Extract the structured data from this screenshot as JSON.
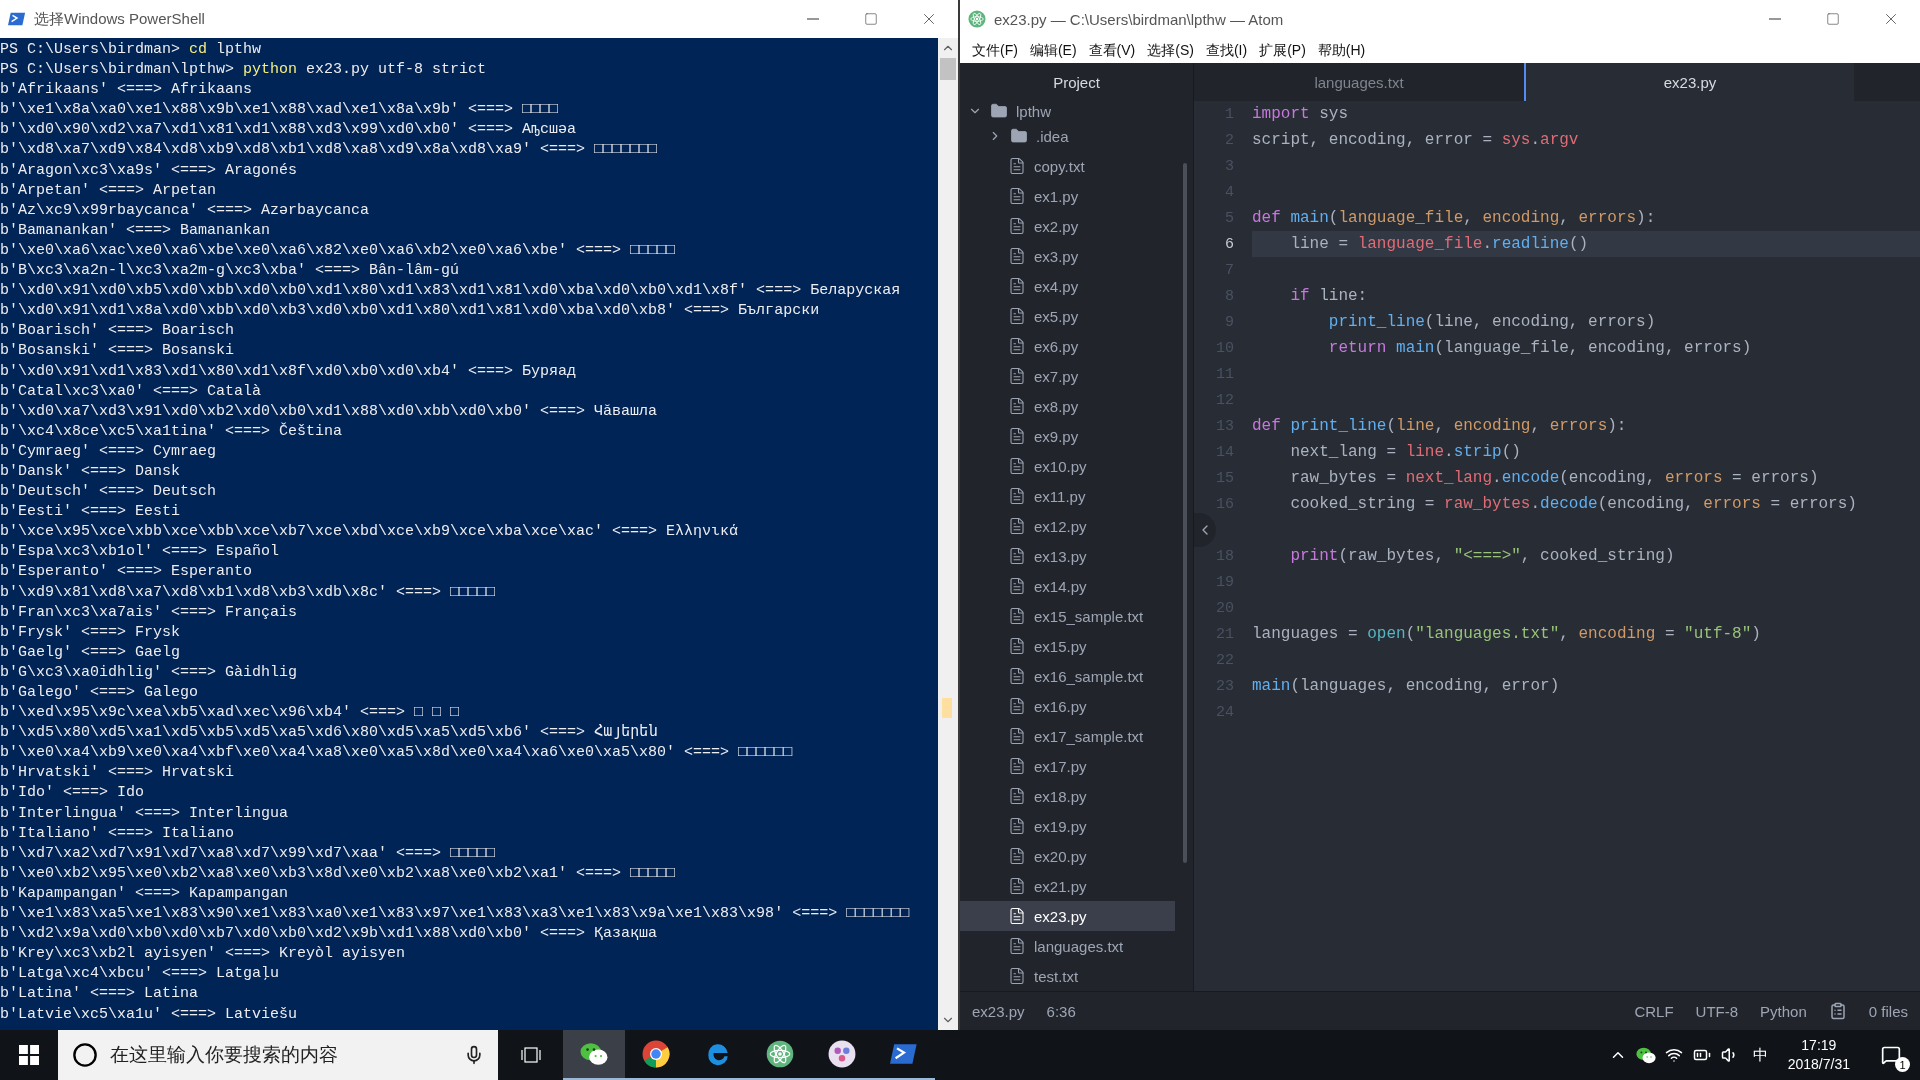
{
  "powershell": {
    "title": "选择Windows PowerShell",
    "lines": [
      {
        "kind": "prompt",
        "prompt": "PS C:\\Users\\birdman> ",
        "command": "cd",
        "args": " lpthw"
      },
      {
        "kind": "prompt",
        "prompt": "PS C:\\Users\\birdman\\lpthw> ",
        "command": "python",
        "args": " ex23.py utf-8 strict"
      },
      {
        "kind": "output",
        "text": "b'Afrikaans' <===> Afrikaans"
      },
      {
        "kind": "output",
        "text": "b'\\xe1\\x8a\\xa0\\xe1\\x88\\x9b\\xe1\\x88\\xad\\xe1\\x8a\\x9b' <===> □□□□"
      },
      {
        "kind": "output",
        "text": "b'\\xd0\\x90\\xd2\\xa7\\xd1\\x81\\xd1\\x88\\xd3\\x99\\xd0\\xb0' <===> Аҧсшәа"
      },
      {
        "kind": "output",
        "text": "b'\\xd8\\xa7\\xd9\\x84\\xd8\\xb9\\xd8\\xb1\\xd8\\xa8\\xd9\\x8a\\xd8\\xa9' <===> □□□□□□□"
      },
      {
        "kind": "output",
        "text": "b'Aragon\\xc3\\xa9s' <===> Aragonés"
      },
      {
        "kind": "output",
        "text": "b'Arpetan' <===> Arpetan"
      },
      {
        "kind": "output",
        "text": "b'Az\\xc9\\x99rbaycanca' <===> Azərbaycanca"
      },
      {
        "kind": "output",
        "text": "b'Bamanankan' <===> Bamanankan"
      },
      {
        "kind": "output",
        "text": "b'\\xe0\\xa6\\xac\\xe0\\xa6\\xbe\\xe0\\xa6\\x82\\xe0\\xa6\\xb2\\xe0\\xa6\\xbe' <===> □□□□□"
      },
      {
        "kind": "output",
        "text": "b'B\\xc3\\xa2n-l\\xc3\\xa2m-g\\xc3\\xba' <===> Bân-lâm-gú"
      },
      {
        "kind": "output",
        "text": "b'\\xd0\\x91\\xd0\\xb5\\xd0\\xbb\\xd0\\xb0\\xd1\\x80\\xd1\\x83\\xd1\\x81\\xd0\\xba\\xd0\\xb0\\xd1\\x8f' <===> Беларуская"
      },
      {
        "kind": "output",
        "text": "b'\\xd0\\x91\\xd1\\x8a\\xd0\\xbb\\xd0\\xb3\\xd0\\xb0\\xd1\\x80\\xd1\\x81\\xd0\\xba\\xd0\\xb8' <===> Български"
      },
      {
        "kind": "output",
        "text": "b'Boarisch' <===> Boarisch"
      },
      {
        "kind": "output",
        "text": "b'Bosanski' <===> Bosanski"
      },
      {
        "kind": "output",
        "text": "b'\\xd0\\x91\\xd1\\x83\\xd1\\x80\\xd1\\x8f\\xd0\\xb0\\xd0\\xb4' <===> Буряад"
      },
      {
        "kind": "output",
        "text": "b'Catal\\xc3\\xa0' <===> Català"
      },
      {
        "kind": "output",
        "text": "b'\\xd0\\xa7\\xd3\\x91\\xd0\\xb2\\xd0\\xb0\\xd1\\x88\\xd0\\xbb\\xd0\\xb0' <===> Чӑвашла"
      },
      {
        "kind": "output",
        "text": "b'\\xc4\\x8ce\\xc5\\xa1tina' <===> Čeština"
      },
      {
        "kind": "output",
        "text": "b'Cymraeg' <===> Cymraeg"
      },
      {
        "kind": "output",
        "text": "b'Dansk' <===> Dansk"
      },
      {
        "kind": "output",
        "text": "b'Deutsch' <===> Deutsch"
      },
      {
        "kind": "output",
        "text": "b'Eesti' <===> Eesti"
      },
      {
        "kind": "output",
        "text": "b'\\xce\\x95\\xce\\xbb\\xce\\xbb\\xce\\xb7\\xce\\xbd\\xce\\xb9\\xce\\xba\\xce\\xac' <===> Ελληνικά"
      },
      {
        "kind": "output",
        "text": "b'Espa\\xc3\\xb1ol' <===> Español"
      },
      {
        "kind": "output",
        "text": "b'Esperanto' <===> Esperanto"
      },
      {
        "kind": "output",
        "text": "b'\\xd9\\x81\\xd8\\xa7\\xd8\\xb1\\xd8\\xb3\\xdb\\x8c' <===> □□□□□"
      },
      {
        "kind": "output",
        "text": "b'Fran\\xc3\\xa7ais' <===> Français"
      },
      {
        "kind": "output",
        "text": "b'Frysk' <===> Frysk"
      },
      {
        "kind": "output",
        "text": "b'Gaelg' <===> Gaelg"
      },
      {
        "kind": "output",
        "text": "b'G\\xc3\\xa0idhlig' <===> Gàidhlig"
      },
      {
        "kind": "output",
        "text": "b'Galego' <===> Galego"
      },
      {
        "kind": "output",
        "text": "b'\\xed\\x95\\x9c\\xea\\xb5\\xad\\xec\\x96\\xb4' <===> □ □ □"
      },
      {
        "kind": "output",
        "text": "b'\\xd5\\x80\\xd5\\xa1\\xd5\\xb5\\xd5\\xa5\\xd6\\x80\\xd5\\xa5\\xd5\\xb6' <===> Հայերեն"
      },
      {
        "kind": "output",
        "text": "b'\\xe0\\xa4\\xb9\\xe0\\xa4\\xbf\\xe0\\xa4\\xa8\\xe0\\xa5\\x8d\\xe0\\xa4\\xa6\\xe0\\xa5\\x80' <===> □□□□□□"
      },
      {
        "kind": "output",
        "text": "b'Hrvatski' <===> Hrvatski"
      },
      {
        "kind": "output",
        "text": "b'Ido' <===> Ido"
      },
      {
        "kind": "output",
        "text": "b'Interlingua' <===> Interlingua"
      },
      {
        "kind": "output",
        "text": "b'Italiano' <===> Italiano"
      },
      {
        "kind": "output",
        "text": "b'\\xd7\\xa2\\xd7\\x91\\xd7\\xa8\\xd7\\x99\\xd7\\xaa' <===> □□□□□"
      },
      {
        "kind": "output",
        "text": "b'\\xe0\\xb2\\x95\\xe0\\xb2\\xa8\\xe0\\xb3\\x8d\\xe0\\xb2\\xa8\\xe0\\xb2\\xa1' <===> □□□□□"
      },
      {
        "kind": "output",
        "text": "b'Kapampangan' <===> Kapampangan"
      },
      {
        "kind": "output",
        "text": "b'\\xe1\\x83\\xa5\\xe1\\x83\\x90\\xe1\\x83\\xa0\\xe1\\x83\\x97\\xe1\\x83\\xa3\\xe1\\x83\\x9a\\xe1\\x83\\x98' <===> □□□□□□□"
      },
      {
        "kind": "output",
        "text": "b'\\xd2\\x9a\\xd0\\xb0\\xd0\\xb7\\xd0\\xb0\\xd2\\x9b\\xd1\\x88\\xd0\\xb0' <===> Қазақша"
      },
      {
        "kind": "output",
        "text": "b'Krey\\xc3\\xb2l ayisyen' <===> Kreyòl ayisyen"
      },
      {
        "kind": "output",
        "text": "b'Latga\\xc4\\xbcu' <===> Latgaļu"
      },
      {
        "kind": "output",
        "text": "b'Latina' <===> Latina"
      },
      {
        "kind": "output",
        "text": "b'Latvie\\xc5\\xa1u' <===> Latviešu"
      }
    ]
  },
  "atom": {
    "title": "ex23.py — C:\\Users\\birdman\\lpthw — Atom",
    "menu": [
      "文件(F)",
      "编辑(E)",
      "查看(V)",
      "选择(S)",
      "查找(I)",
      "扩展(P)",
      "帮助(H)"
    ],
    "tree": {
      "header": "Project",
      "root": {
        "name": "lpthw",
        "expanded": true,
        "children": [
          {
            "kind": "folder",
            "name": ".idea",
            "expanded": false,
            "selected": false
          },
          {
            "kind": "file",
            "name": "copy.txt",
            "selected": false
          },
          {
            "kind": "file",
            "name": "ex1.py",
            "selected": false
          },
          {
            "kind": "file",
            "name": "ex2.py",
            "selected": false
          },
          {
            "kind": "file",
            "name": "ex3.py",
            "selected": false
          },
          {
            "kind": "file",
            "name": "ex4.py",
            "selected": false
          },
          {
            "kind": "file",
            "name": "ex5.py",
            "selected": false
          },
          {
            "kind": "file",
            "name": "ex6.py",
            "selected": false
          },
          {
            "kind": "file",
            "name": "ex7.py",
            "selected": false
          },
          {
            "kind": "file",
            "name": "ex8.py",
            "selected": false
          },
          {
            "kind": "file",
            "name": "ex9.py",
            "selected": false
          },
          {
            "kind": "file",
            "name": "ex10.py",
            "selected": false
          },
          {
            "kind": "file",
            "name": "ex11.py",
            "selected": false
          },
          {
            "kind": "file",
            "name": "ex12.py",
            "selected": false
          },
          {
            "kind": "file",
            "name": "ex13.py",
            "selected": false
          },
          {
            "kind": "file",
            "name": "ex14.py",
            "selected": false
          },
          {
            "kind": "file",
            "name": "ex15_sample.txt",
            "selected": false
          },
          {
            "kind": "file",
            "name": "ex15.py",
            "selected": false
          },
          {
            "kind": "file",
            "name": "ex16_sample.txt",
            "selected": false
          },
          {
            "kind": "file",
            "name": "ex16.py",
            "selected": false
          },
          {
            "kind": "file",
            "name": "ex17_sample.txt",
            "selected": false
          },
          {
            "kind": "file",
            "name": "ex17.py",
            "selected": false
          },
          {
            "kind": "file",
            "name": "ex18.py",
            "selected": false
          },
          {
            "kind": "file",
            "name": "ex19.py",
            "selected": false
          },
          {
            "kind": "file",
            "name": "ex20.py",
            "selected": false
          },
          {
            "kind": "file",
            "name": "ex21.py",
            "selected": false
          },
          {
            "kind": "file",
            "name": "ex23.py",
            "selected": true
          },
          {
            "kind": "file",
            "name": "languages.txt",
            "selected": false
          },
          {
            "kind": "file",
            "name": "test.txt",
            "selected": false
          }
        ]
      }
    },
    "tabs": [
      {
        "label": "languages.txt",
        "selected": false
      },
      {
        "label": "ex23.py",
        "selected": true
      }
    ],
    "lines": [
      {
        "number": "1",
        "current": false,
        "tokens": [
          {
            "kind": "keyword",
            "text": "import"
          },
          {
            "kind": "plain",
            "text": " sys"
          }
        ]
      },
      {
        "number": "2",
        "current": false,
        "tokens": [
          {
            "kind": "plain",
            "text": "script, encoding, error = "
          },
          {
            "kind": "variable",
            "text": "sys"
          },
          {
            "kind": "plain",
            "text": "."
          },
          {
            "kind": "variable",
            "text": "argv"
          }
        ]
      },
      {
        "number": "3",
        "current": false
      },
      {
        "number": "4",
        "current": false
      },
      {
        "number": "5",
        "current": false,
        "tokens": [
          {
            "kind": "keyword",
            "text": "def "
          },
          {
            "kind": "function",
            "text": "main"
          },
          {
            "kind": "plain",
            "text": "("
          },
          {
            "kind": "param",
            "text": "language_file"
          },
          {
            "kind": "plain",
            "text": ", "
          },
          {
            "kind": "param",
            "text": "encoding"
          },
          {
            "kind": "plain",
            "text": ", "
          },
          {
            "kind": "param",
            "text": "errors"
          },
          {
            "kind": "plain",
            "text": "):"
          }
        ]
      },
      {
        "number": "6",
        "current": true,
        "tokens": [
          {
            "kind": "plain",
            "text": "    line = "
          },
          {
            "kind": "variable",
            "text": "language_file"
          },
          {
            "kind": "plain",
            "text": "."
          },
          {
            "kind": "function",
            "text": "readline"
          },
          {
            "kind": "plain",
            "text": "()"
          }
        ]
      },
      {
        "number": "7",
        "current": false
      },
      {
        "number": "8",
        "current": false,
        "tokens": [
          {
            "kind": "keyword",
            "text": "    if"
          },
          {
            "kind": "plain",
            "text": " line:"
          }
        ]
      },
      {
        "number": "9",
        "current": false,
        "tokens": [
          {
            "kind": "function",
            "text": "        print_line"
          },
          {
            "kind": "plain",
            "text": "(line, encoding, errors)"
          }
        ]
      },
      {
        "number": "10",
        "current": false,
        "tokens": [
          {
            "kind": "keyword",
            "text": "        return "
          },
          {
            "kind": "function",
            "text": "main"
          },
          {
            "kind": "plain",
            "text": "(language_file, encoding, errors)"
          }
        ]
      },
      {
        "number": "11",
        "current": false
      },
      {
        "number": "12",
        "current": false
      },
      {
        "number": "13",
        "current": false,
        "tokens": [
          {
            "kind": "keyword",
            "text": "def "
          },
          {
            "kind": "function",
            "text": "print_line"
          },
          {
            "kind": "plain",
            "text": "("
          },
          {
            "kind": "param",
            "text": "line"
          },
          {
            "kind": "plain",
            "text": ", "
          },
          {
            "kind": "param",
            "text": "encoding"
          },
          {
            "kind": "plain",
            "text": ", "
          },
          {
            "kind": "param",
            "text": "errors"
          },
          {
            "kind": "plain",
            "text": "):"
          }
        ]
      },
      {
        "number": "14",
        "current": false,
        "tokens": [
          {
            "kind": "plain",
            "text": "    next_lang = "
          },
          {
            "kind": "variable",
            "text": "line"
          },
          {
            "kind": "plain",
            "text": "."
          },
          {
            "kind": "function",
            "text": "strip"
          },
          {
            "kind": "plain",
            "text": "()"
          }
        ]
      },
      {
        "number": "15",
        "current": false,
        "tokens": [
          {
            "kind": "plain",
            "text": "    raw_bytes = "
          },
          {
            "kind": "variable",
            "text": "next_lang"
          },
          {
            "kind": "plain",
            "text": "."
          },
          {
            "kind": "function",
            "text": "encode"
          },
          {
            "kind": "plain",
            "text": "(encoding, "
          },
          {
            "kind": "param",
            "text": "errors"
          },
          {
            "kind": "plain",
            "text": " = errors)"
          }
        ]
      },
      {
        "number": "16",
        "current": false,
        "tokens": [
          {
            "kind": "plain",
            "text": "    cooked_string = "
          },
          {
            "kind": "variable",
            "text": "raw_bytes"
          },
          {
            "kind": "plain",
            "text": "."
          },
          {
            "kind": "function",
            "text": "decode"
          },
          {
            "kind": "plain",
            "text": "(encoding, "
          },
          {
            "kind": "param",
            "text": "errors"
          },
          {
            "kind": "plain",
            "text": " = errors)"
          }
        ]
      },
      {
        "current": false
      },
      {
        "number": "18",
        "current": false,
        "tokens": [
          {
            "kind": "keyword",
            "text": "    print"
          },
          {
            "kind": "plain",
            "text": "(raw_bytes, "
          },
          {
            "kind": "string",
            "text": "\"<===>\""
          },
          {
            "kind": "plain",
            "text": ", cooked_string)"
          }
        ]
      },
      {
        "number": "19",
        "current": false
      },
      {
        "number": "20",
        "current": false
      },
      {
        "number": "21",
        "current": false,
        "tokens": [
          {
            "kind": "plain",
            "text": "languages = "
          },
          {
            "kind": "builtin",
            "text": "open"
          },
          {
            "kind": "plain",
            "text": "("
          },
          {
            "kind": "string",
            "text": "\"languages.txt\""
          },
          {
            "kind": "plain",
            "text": ", "
          },
          {
            "kind": "param",
            "text": "encoding"
          },
          {
            "kind": "plain",
            "text": " = "
          },
          {
            "kind": "string",
            "text": "\"utf-8\""
          },
          {
            "kind": "plain",
            "text": ")"
          }
        ]
      },
      {
        "number": "22",
        "current": false
      },
      {
        "number": "23",
        "current": false,
        "tokens": [
          {
            "kind": "function",
            "text": "main"
          },
          {
            "kind": "plain",
            "text": "(languages, encoding, error)"
          }
        ]
      },
      {
        "number": "24",
        "current": false
      }
    ],
    "status_bar": {
      "file": "ex23.py",
      "cursor": "6:36",
      "line_ending": "CRLF",
      "encoding": "UTF-8",
      "grammar": "Python",
      "git": "0 files"
    }
  },
  "taskbar": {
    "search": {
      "placeholder": "在这里输入你要搜索的内容"
    },
    "apps": [
      {
        "kind": "wechat",
        "active": true
      },
      {
        "kind": "chrome",
        "active": false
      },
      {
        "kind": "edge",
        "active": false
      },
      {
        "kind": "atom",
        "active": false
      },
      {
        "kind": "photos",
        "active": false
      },
      {
        "kind": "powershell",
        "active": false
      }
    ],
    "tray": {
      "ime": "中",
      "time": "17:19",
      "date": "2018/7/31",
      "notifications": "1"
    }
  }
}
